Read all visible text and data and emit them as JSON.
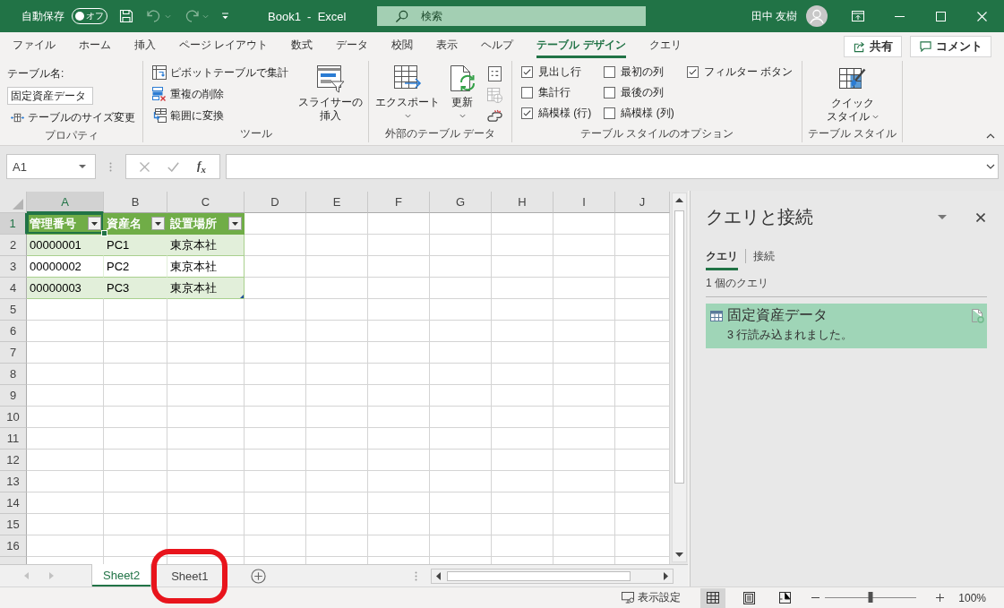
{
  "title_bar": {
    "autosave": {
      "label": "自動保存",
      "state_text": "オフ",
      "on": false
    },
    "quick_access": [
      {
        "kind": "save",
        "disabled": false
      },
      {
        "kind": "undo",
        "disabled": true
      },
      {
        "kind": "redo",
        "disabled": true
      },
      {
        "kind": "customize",
        "disabled": false
      }
    ],
    "title": "Book1  -  Excel",
    "search": {
      "placeholder": "検索"
    },
    "user_name": "田中 友樹"
  },
  "ribbon_tabs": [
    {
      "label": "ファイル",
      "selected": false
    },
    {
      "label": "ホーム",
      "selected": false
    },
    {
      "label": "挿入",
      "selected": false
    },
    {
      "label": "ページ レイアウト",
      "selected": false
    },
    {
      "label": "数式",
      "selected": false
    },
    {
      "label": "データ",
      "selected": false
    },
    {
      "label": "校閲",
      "selected": false
    },
    {
      "label": "表示",
      "selected": false
    },
    {
      "label": "ヘルプ",
      "selected": false
    },
    {
      "label": "テーブル デザイン",
      "selected": true
    },
    {
      "label": "クエリ",
      "selected": false
    }
  ],
  "header_buttons": [
    {
      "kind": "share",
      "label": "共有"
    },
    {
      "kind": "comment",
      "label": "コメント"
    }
  ],
  "ribbon": {
    "properties": {
      "group_label": "プロパティ",
      "table_name_label": "テーブル名:",
      "table_name": "固定資産データ",
      "resize_button": "テーブルのサイズ変更"
    },
    "tools": {
      "group_label": "ツール",
      "small_buttons": [
        {
          "kind": "pivot",
          "label": "ピボットテーブルで集計"
        },
        {
          "kind": "dedupe",
          "label": "重複の削除"
        },
        {
          "kind": "convert",
          "label": "範囲に変換"
        }
      ],
      "slicer_button": [
        "スライサーの",
        "挿入"
      ]
    },
    "external_data": {
      "group_label": "外部のテーブル データ",
      "large_buttons": [
        {
          "kind": "export",
          "label": "エクスポート"
        },
        {
          "kind": "refresh",
          "label": "更新"
        }
      ],
      "small_buttons": [
        {
          "kind": "properties",
          "disabled": false
        },
        {
          "kind": "browser",
          "disabled": true
        },
        {
          "kind": "unlink",
          "disabled": false
        }
      ]
    },
    "style_options": {
      "group_label": "テーブル スタイルのオプション",
      "options": [
        {
          "label": "見出し行",
          "checked": true
        },
        {
          "label": "集計行",
          "checked": false
        },
        {
          "label": "縞模様 (行)",
          "checked": true
        },
        {
          "label": "最初の列",
          "checked": false
        },
        {
          "label": "最後の列",
          "checked": false
        },
        {
          "label": "縞模様 (列)",
          "checked": false
        },
        {
          "label": "フィルター ボタン",
          "checked": true
        }
      ]
    },
    "table_styles": {
      "group_label": "テーブル スタイル",
      "quick_styles_button": [
        "クイック",
        "スタイル"
      ]
    }
  },
  "formula_bar": {
    "name_box": "A1",
    "editing": false,
    "insert_function": "f$_{x}$"
  },
  "sheet": {
    "columns": [
      {
        "label": "A",
        "selected": true
      },
      {
        "label": "B",
        "selected": false
      },
      {
        "label": "C",
        "selected": false
      },
      {
        "label": "D",
        "selected": false
      },
      {
        "label": "E",
        "selected": false
      },
      {
        "label": "F",
        "selected": false
      },
      {
        "label": "G",
        "selected": false
      },
      {
        "label": "H",
        "selected": false
      },
      {
        "label": "I",
        "selected": false
      },
      {
        "label": "J",
        "selected": false
      }
    ],
    "rows": [
      {
        "label": "1",
        "selected": true
      },
      {
        "label": "2",
        "selected": false
      },
      {
        "label": "3",
        "selected": false
      },
      {
        "label": "4",
        "selected": false
      },
      {
        "label": "5",
        "selected": false
      },
      {
        "label": "6",
        "selected": false
      },
      {
        "label": "7",
        "selected": false
      },
      {
        "label": "8",
        "selected": false
      },
      {
        "label": "9",
        "selected": false
      },
      {
        "label": "10",
        "selected": false
      },
      {
        "label": "11",
        "selected": false
      },
      {
        "label": "12",
        "selected": false
      },
      {
        "label": "13",
        "selected": false
      },
      {
        "label": "14",
        "selected": false
      },
      {
        "label": "15",
        "selected": false
      },
      {
        "label": "16",
        "selected": false
      }
    ],
    "table": {
      "headers": [
        "管理番号",
        "資産名",
        "設置場所"
      ],
      "rows": [
        [
          "00000001",
          "PC1",
          "東京本社"
        ],
        [
          "00000002",
          "PC2",
          "東京本社"
        ],
        [
          "00000003",
          "PC3",
          "東京本社"
        ]
      ]
    }
  },
  "queries_pane": {
    "title": "クエリと接続",
    "tabs": [
      {
        "label": "クエリ",
        "selected": true
      },
      {
        "label": "接続",
        "selected": false
      }
    ],
    "count": "1 個のクエリ",
    "queries": [
      {
        "name": "固定資産データ",
        "status": "3 行読み込まれました。",
        "selected": true
      }
    ]
  },
  "sheet_tabs": [
    {
      "label": "Sheet2",
      "selected": true,
      "circled": false
    },
    {
      "label": "Sheet1",
      "selected": false,
      "circled": true
    }
  ],
  "status_bar": {
    "display_settings": "表示設定",
    "views": [
      {
        "kind": "normal",
        "selected": true
      },
      {
        "kind": "page_layout",
        "selected": false
      },
      {
        "kind": "page_break",
        "selected": false
      }
    ],
    "zoom": {
      "level": 0.5,
      "label": "100%"
    }
  }
}
